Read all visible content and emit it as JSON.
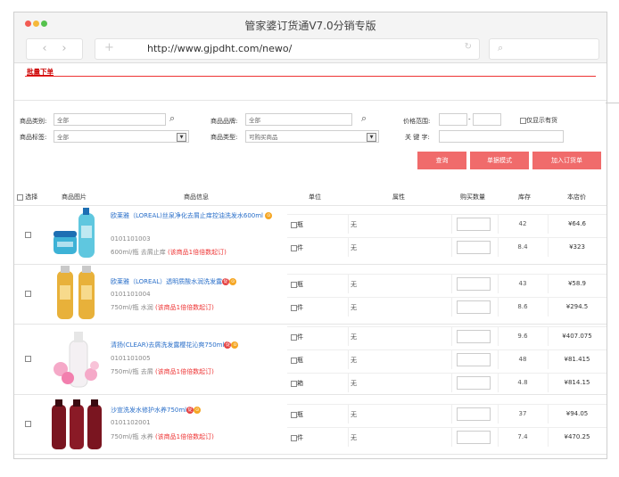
{
  "window": {
    "title": "管家婆订货通V7.0分销专版",
    "url": "http://www.gjpdht.com/newo/"
  },
  "colors": {
    "accent": "#f06b6b",
    "link": "#2a6fc9",
    "danger": "#e33333"
  },
  "batch_order_link": "批量下单",
  "filters": {
    "category_label": "商品类别:",
    "category_value": "全部",
    "brand_label": "商品品牌:",
    "brand_value": "全部",
    "price_label": "价格范围:",
    "instock_label": "仅显示有货",
    "tag_label": "商品标签:",
    "tag_value": "全部",
    "type_label": "商品类型:",
    "type_value": "可购买商品",
    "keyword_label": "关 键 字:"
  },
  "buttons": {
    "query": "查询",
    "batch_mode": "单据模式",
    "add_order": "加入订货单"
  },
  "table": {
    "headers": {
      "select": "选择",
      "image": "商品图片",
      "info": "商品信息",
      "unit": "单位",
      "attr": "属性",
      "qty": "购买数量",
      "stock": "库存",
      "price": "本店价"
    },
    "rows": [
      {
        "name": "欧莱雅（LOREAL)丝泉净化去屑止痒控油洗发水600ml",
        "code": "0101101003",
        "spec": "600ml/瓶 去屑止痒",
        "note": "(该商品1倍倍数起订)",
        "units": [
          {
            "unit": "瓶",
            "attr": "无",
            "stock": "42",
            "price": "¥64.6"
          },
          {
            "unit": "件",
            "attr": "无",
            "stock": "8.4",
            "price": "¥323"
          }
        ]
      },
      {
        "name": "欧莱雅（LOREAL）透明质酸水润洗发露",
        "code": "0101101004",
        "spec": "750ml/瓶 水润",
        "note": "(该商品1倍倍数起订)",
        "units": [
          {
            "unit": "瓶",
            "attr": "无",
            "stock": "43",
            "price": "¥58.9"
          },
          {
            "unit": "件",
            "attr": "无",
            "stock": "8.6",
            "price": "¥294.5"
          }
        ]
      },
      {
        "name": "清扬(CLEAR)去屑洗发露樱花沁爽750ml",
        "code": "0101101005",
        "spec": "750ml/瓶 去屑",
        "note": "(该商品1倍倍数起订)",
        "units": [
          {
            "unit": "件",
            "attr": "无",
            "stock": "9.6",
            "price": "¥407.075"
          },
          {
            "unit": "瓶",
            "attr": "无",
            "stock": "48",
            "price": "¥81.415"
          },
          {
            "unit": "箱",
            "attr": "无",
            "stock": "4.8",
            "price": "¥814.15"
          }
        ]
      },
      {
        "name": "沙宣洗发水修护水养750ml",
        "code": "0101102001",
        "spec": "750ml/瓶 水养",
        "note": "(该商品1倍倍数起订)",
        "units": [
          {
            "unit": "瓶",
            "attr": "无",
            "stock": "37",
            "price": "¥94.05"
          },
          {
            "unit": "件",
            "attr": "无",
            "stock": "7.4",
            "price": "¥470.25"
          }
        ]
      }
    ]
  }
}
